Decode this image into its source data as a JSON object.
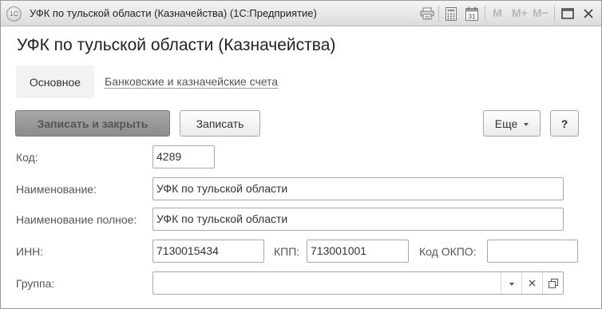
{
  "window": {
    "title": "УФК по тульской области (Казначейства)  (1С:Предприятие)",
    "logo_text": "1С",
    "memory_buttons": [
      "M",
      "M+",
      "M−"
    ]
  },
  "form": {
    "title": "УФК по тульской области (Казначейства)",
    "tabs": [
      "Основное",
      "Банковские и казначейские счета"
    ]
  },
  "commands": {
    "save_close": "Записать и закрыть",
    "save": "Записать",
    "more": "Еще",
    "help": "?"
  },
  "fields": {
    "code": {
      "label": "Код:",
      "value": "4289"
    },
    "name": {
      "label": "Наименование:",
      "value": "УФК по тульской области"
    },
    "full_name": {
      "label": "Наименование полное:",
      "value": "УФК по тульской области"
    },
    "inn": {
      "label": "ИНН:",
      "value": "7130015434"
    },
    "kpp": {
      "label": "КПП:",
      "value": "713001001"
    },
    "okpo": {
      "label": "Код ОКПО:",
      "value": ""
    },
    "group": {
      "label": "Группа:",
      "value": ""
    }
  },
  "icons": {
    "titlebar": [
      "printer-icon",
      "calculator-icon",
      "calendar-icon",
      "restore-icon",
      "close-icon"
    ],
    "calendar_day": "31",
    "group_field": [
      "dropdown-icon",
      "clear-icon",
      "open-icon"
    ]
  }
}
